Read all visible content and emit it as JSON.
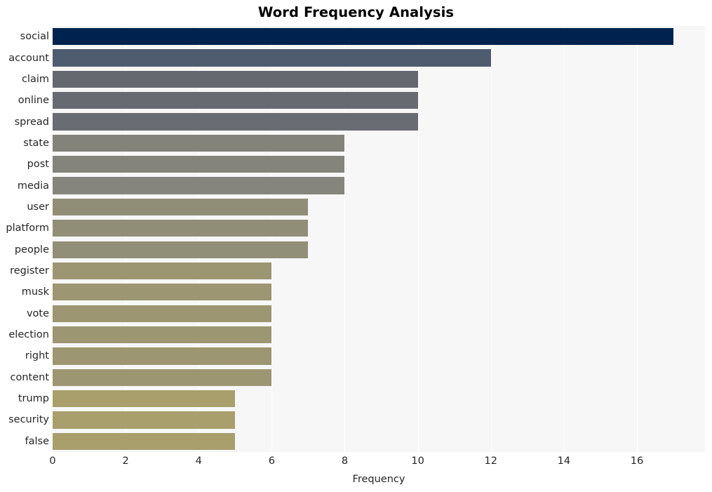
{
  "chart_data": {
    "type": "bar",
    "orientation": "horizontal",
    "title": "Word Frequency Analysis",
    "xlabel": "Frequency",
    "ylabel": "",
    "categories": [
      "social",
      "account",
      "claim",
      "online",
      "spread",
      "state",
      "post",
      "media",
      "user",
      "platform",
      "people",
      "register",
      "musk",
      "vote",
      "election",
      "right",
      "content",
      "trump",
      "security",
      "false"
    ],
    "values": [
      17,
      12,
      10,
      10,
      10,
      8,
      8,
      8,
      7,
      7,
      7,
      6,
      6,
      6,
      6,
      6,
      6,
      5,
      5,
      5
    ],
    "bar_colors": [
      "#00224e",
      "#4f5b6e",
      "#666870",
      "#686a72",
      "#6a6c73",
      "#83837c",
      "#84847c",
      "#85857d",
      "#918e78",
      "#918e78",
      "#928f78",
      "#9c9672",
      "#9c9672",
      "#9c9672",
      "#9c9672",
      "#9c9672",
      "#9c9672",
      "#a89f6d",
      "#a89f6d",
      "#a89f6d"
    ],
    "xlim": [
      0,
      17.3
    ],
    "xticks": [
      0,
      2,
      4,
      6,
      8,
      10,
      12,
      14,
      16
    ],
    "xtick_labels": [
      "0",
      "2",
      "4",
      "6",
      "8",
      "10",
      "12",
      "14",
      "16"
    ],
    "grid": "vertical-white",
    "plot_background": "#f7f7f7",
    "figure_background": "#ffffff",
    "legend": null
  }
}
